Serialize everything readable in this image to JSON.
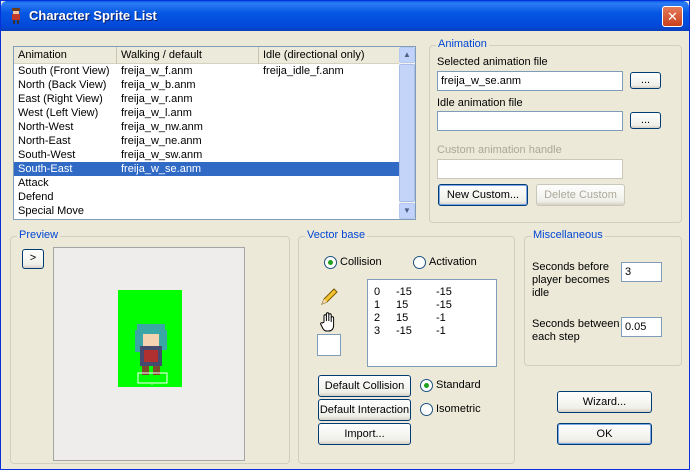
{
  "window": {
    "title": "Character Sprite List",
    "close_glyph": "✕"
  },
  "list": {
    "columns": [
      "Animation",
      "Walking / default",
      "Idle (directional only)"
    ],
    "rows": [
      {
        "name": "South (Front View)",
        "walk": "freija_w_f.anm",
        "idle": "freija_idle_f.anm"
      },
      {
        "name": "North (Back View)",
        "walk": "freija_w_b.anm",
        "idle": ""
      },
      {
        "name": "East (Right View)",
        "walk": "freija_w_r.anm",
        "idle": ""
      },
      {
        "name": "West (Left View)",
        "walk": "freija_w_l.anm",
        "idle": ""
      },
      {
        "name": "North-West",
        "walk": "freija_w_nw.anm",
        "idle": ""
      },
      {
        "name": "North-East",
        "walk": "freija_w_ne.anm",
        "idle": ""
      },
      {
        "name": "South-West",
        "walk": "freija_w_sw.anm",
        "idle": ""
      },
      {
        "name": "South-East",
        "walk": "freija_w_se.anm",
        "idle": ""
      },
      {
        "name": "Attack",
        "walk": "",
        "idle": ""
      },
      {
        "name": "Defend",
        "walk": "",
        "idle": ""
      },
      {
        "name": "Special Move",
        "walk": "",
        "idle": ""
      }
    ],
    "selected_row": "South-East"
  },
  "animation": {
    "title": "Animation",
    "selected_file_label": "Selected animation file",
    "selected_file_value": "freija_w_se.anm",
    "browse_label": "...",
    "idle_file_label": "Idle animation file",
    "idle_file_value": "",
    "custom_handle_label": "Custom animation handle",
    "custom_handle_value": "",
    "new_custom": "New Custom...",
    "delete_custom": "Delete Custom"
  },
  "preview": {
    "title": "Preview",
    "play_glyph": ">"
  },
  "vector": {
    "title": "Vector base",
    "collision": "Collision",
    "activation": "Activation",
    "rows": [
      {
        "i": "0",
        "x": "-15",
        "y": "-15"
      },
      {
        "i": "1",
        "x": "15",
        "y": "-15"
      },
      {
        "i": "2",
        "x": "15",
        "y": "-1"
      },
      {
        "i": "3",
        "x": "-15",
        "y": "-1"
      }
    ],
    "default_collision": "Default Collision",
    "default_interaction": "Default Interaction",
    "import": "Import...",
    "standard": "Standard",
    "isometric": "Isometric"
  },
  "misc": {
    "title": "Miscellaneous",
    "idle_seconds_label": "Seconds before player becomes idle",
    "idle_seconds_value": "3",
    "step_seconds_label": "Seconds between each step",
    "step_seconds_value": "0.05"
  },
  "buttons": {
    "wizard": "Wizard...",
    "ok": "OK"
  },
  "icons": {
    "title": "character-sprite-icon",
    "pencil": "pencil-icon",
    "hand": "hand-icon"
  }
}
